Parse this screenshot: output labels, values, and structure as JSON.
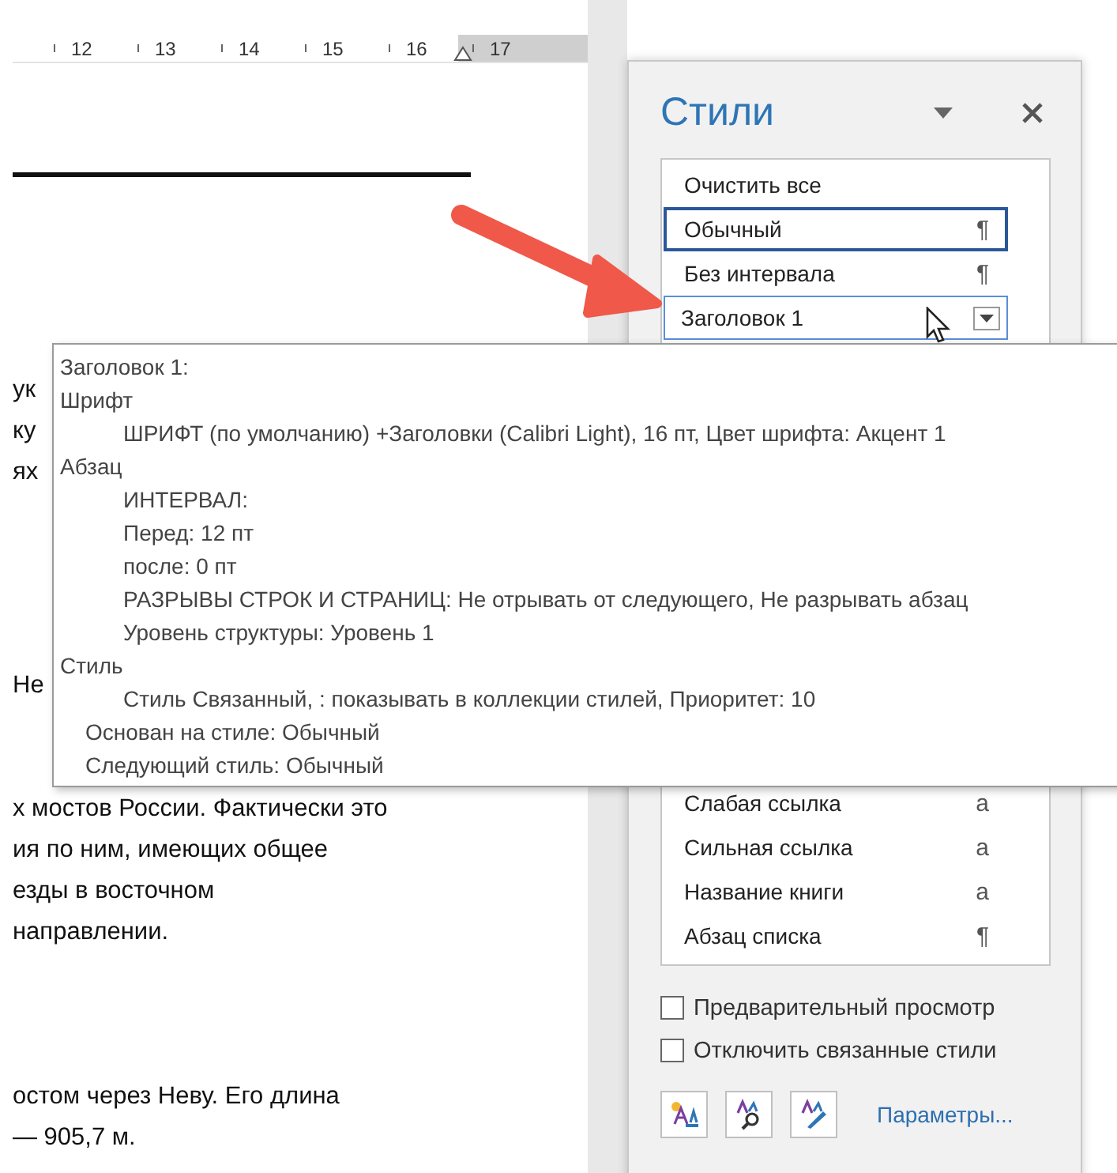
{
  "ruler": {
    "labels": [
      "12",
      "13",
      "14",
      "15",
      "16",
      "17"
    ]
  },
  "document": {
    "paragraphs": [
      {
        "lines": [
          "ук",
          "ку",
          "ях"
        ]
      },
      {
        "lines": [
          "Не"
        ]
      },
      {
        "lines": [
          "х мостов России. Фактически это",
          "ия по ним, имеющих общее",
          "езды в восточном",
          "направлении."
        ]
      },
      {
        "lines": [
          "остом через Неву. Его длина",
          "— 905,7 м."
        ]
      }
    ]
  },
  "styles_pane": {
    "title": "Стили",
    "styles_top": [
      {
        "name": "Очистить все",
        "selected": false,
        "hovered": false
      },
      {
        "name": "Обычный",
        "mark": "¶",
        "selected": true,
        "hovered": false
      },
      {
        "name": "Без интервала",
        "mark": "¶",
        "selected": false,
        "hovered": false
      },
      {
        "name": "Заголовок 1",
        "selected": false,
        "hovered": true
      }
    ],
    "styles_bottom": [
      {
        "name": "Слабая ссылка",
        "mark": "a",
        "selected": false,
        "hovered": false
      },
      {
        "name": "Сильная ссылка",
        "mark": "a",
        "selected": false,
        "hovered": false
      },
      {
        "name": "Название книги",
        "mark": "a",
        "selected": false,
        "hovered": false
      },
      {
        "name": "Абзац списка",
        "mark": "¶",
        "selected": false,
        "hovered": false
      }
    ],
    "options": [
      {
        "label": "Предварительный просмотр",
        "checked": false
      },
      {
        "label": "Отключить связанные стили",
        "checked": false
      }
    ],
    "tools": [
      {
        "kind": "new"
      },
      {
        "kind": "inspect"
      },
      {
        "kind": "manage"
      }
    ],
    "link": "Параметры..."
  },
  "tooltip": {
    "lines": [
      {
        "kind": "title",
        "text": "Заголовок 1:"
      },
      {
        "kind": "section",
        "text": "Шрифт",
        "children": [
          {
            "text": "ШРИФТ (по умолчанию) +Заголовки (Calibri Light), 16 пт, Цвет шрифта: Акцент 1"
          }
        ]
      },
      {
        "kind": "section",
        "text": "Абзац",
        "children": [
          {
            "text": "ИНТЕРВАЛ:"
          },
          {
            "text": "Перед:  12 пт"
          },
          {
            "text": "после: 0 пт"
          },
          {
            "text": "РАЗРЫВЫ СТРОК И СТРАНИЦ: Не отрывать от следующего, Не разрывать абзац"
          },
          {
            "text": "Уровень структуры:  Уровень 1"
          }
        ]
      },
      {
        "kind": "section",
        "text": "Стиль",
        "children": [
          {
            "text": "Стиль Связанный, : показывать в коллекции стилей, Приоритет: 10"
          }
        ]
      },
      {
        "kind": "note",
        "text": "Основан на стиле: Обычный"
      },
      {
        "kind": "note",
        "text": "Следующий стиль: Обычный"
      }
    ]
  }
}
